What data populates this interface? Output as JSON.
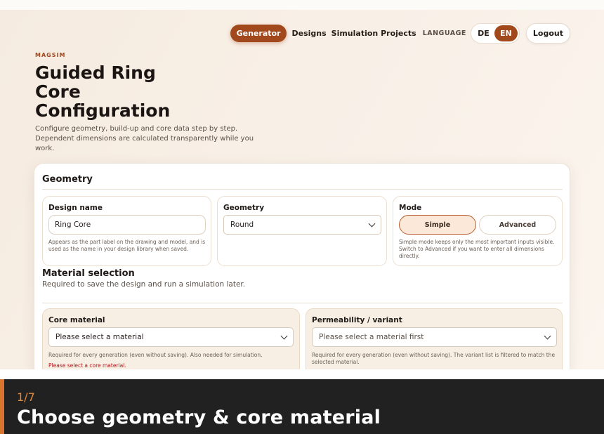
{
  "nav": {
    "items": [
      "Generator",
      "Designs",
      "Simulation Projects"
    ],
    "active": "Generator",
    "language_label": "LANGUAGE",
    "languages": [
      "DE",
      "EN"
    ],
    "active_language": "EN",
    "logout": "Logout"
  },
  "hero": {
    "eyebrow": "MAGSIM",
    "title": "Guided Ring Core Configuration",
    "lead": "Configure geometry, build-up and core data step by step. Dependent dimensions are calculated transparently while you work."
  },
  "geometry": {
    "title": "Geometry",
    "design_name": {
      "label": "Design name",
      "value": "Ring Core",
      "help": "Appears as the part label on the drawing and model, and is used as the name in your design library when saved."
    },
    "geometry_select": {
      "label": "Geometry",
      "value": "Round"
    },
    "mode": {
      "label": "Mode",
      "options": [
        "Simple",
        "Advanced"
      ],
      "active": "Simple",
      "help": "Simple mode keeps only the most important inputs visible. Switch to Advanced if you want to enter all dimensions directly."
    }
  },
  "material": {
    "title": "Material selection",
    "subtitle": "Required to save the design and run a simulation later.",
    "core": {
      "label": "Core material",
      "value": "Please select a material",
      "help": "Required for every generation (even without saving). Also needed for simulation.",
      "error": "Please select a core material."
    },
    "permeability": {
      "label": "Permeability / variant",
      "value": "Please select a material first",
      "help": "Required for every generation (even without saving). The variant list is filtered to match the selected material."
    }
  },
  "caption": {
    "step": "1/7",
    "title": "Choose geometry & core material"
  },
  "colors": {
    "accent": "#a1481c",
    "caption_bg": "#212121",
    "caption_accent": "#d9752f",
    "error": "#b0161c"
  }
}
